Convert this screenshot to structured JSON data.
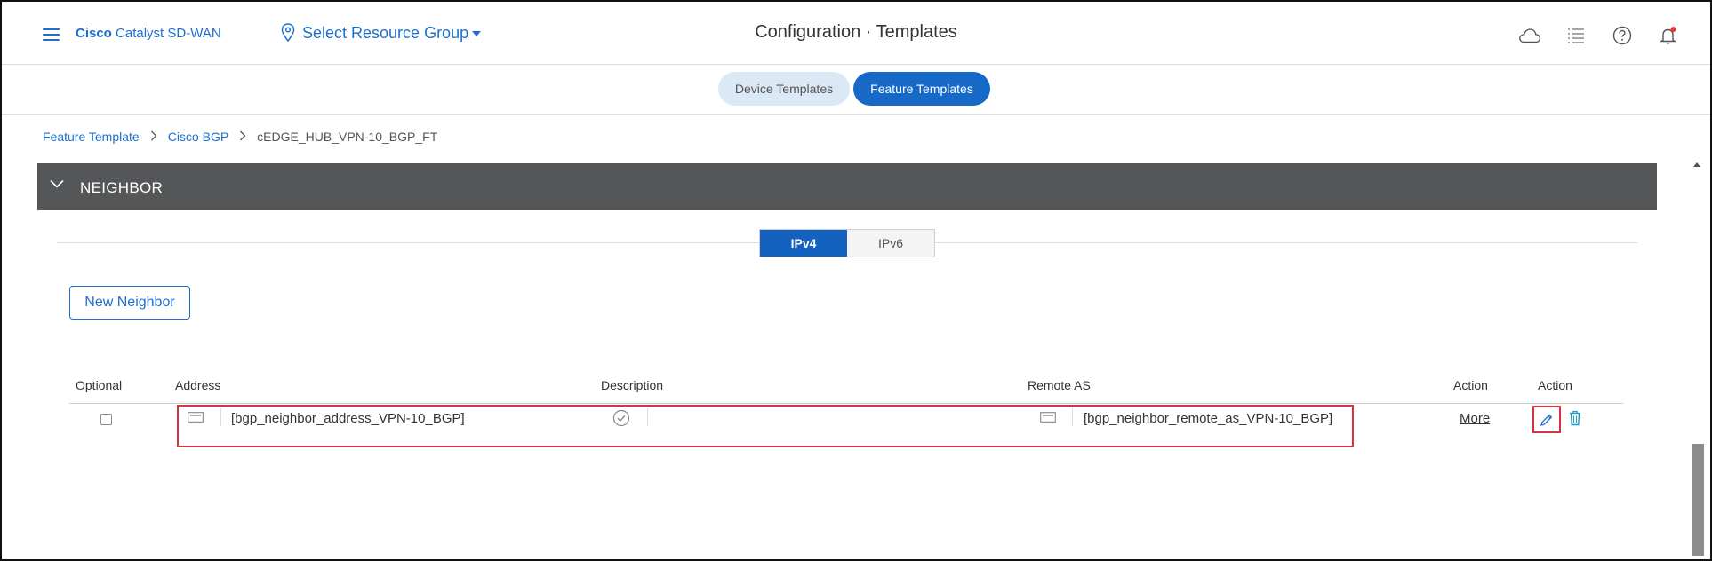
{
  "header": {
    "brand_bold": "Cisco",
    "brand_rest": "Catalyst SD-WAN",
    "resource_group": "Select Resource Group",
    "title": "Configuration · Templates",
    "icons": [
      "cloud-icon",
      "list-icon",
      "help-icon",
      "bell-icon"
    ]
  },
  "tabs": {
    "device": "Device Templates",
    "feature": "Feature Templates",
    "active": "Feature Templates"
  },
  "breadcrumb": [
    "Feature Template",
    "Cisco BGP",
    "cEDGE_HUB_VPN-10_BGP_FT"
  ],
  "section": {
    "title": "NEIGHBOR",
    "expanded": true
  },
  "ip_toggle": {
    "options": [
      "IPv4",
      "IPv6"
    ],
    "selected": "IPv4"
  },
  "new_neighbor_button": "New Neighbor",
  "table": {
    "headers": [
      "Optional",
      "Address",
      "Description",
      "Remote AS",
      "Action",
      "Action"
    ],
    "rows": [
      {
        "optional": false,
        "address": "[bgp_neighbor_address_VPN-10_BGP]",
        "description": "",
        "remote_as": "[bgp_neighbor_remote_as_VPN-10_BGP]",
        "more": "More"
      }
    ]
  },
  "colors": {
    "accent": "#1f6fd0",
    "active_tab": "#1769c7",
    "section_bg": "#555658",
    "highlight": "#d9333f"
  }
}
